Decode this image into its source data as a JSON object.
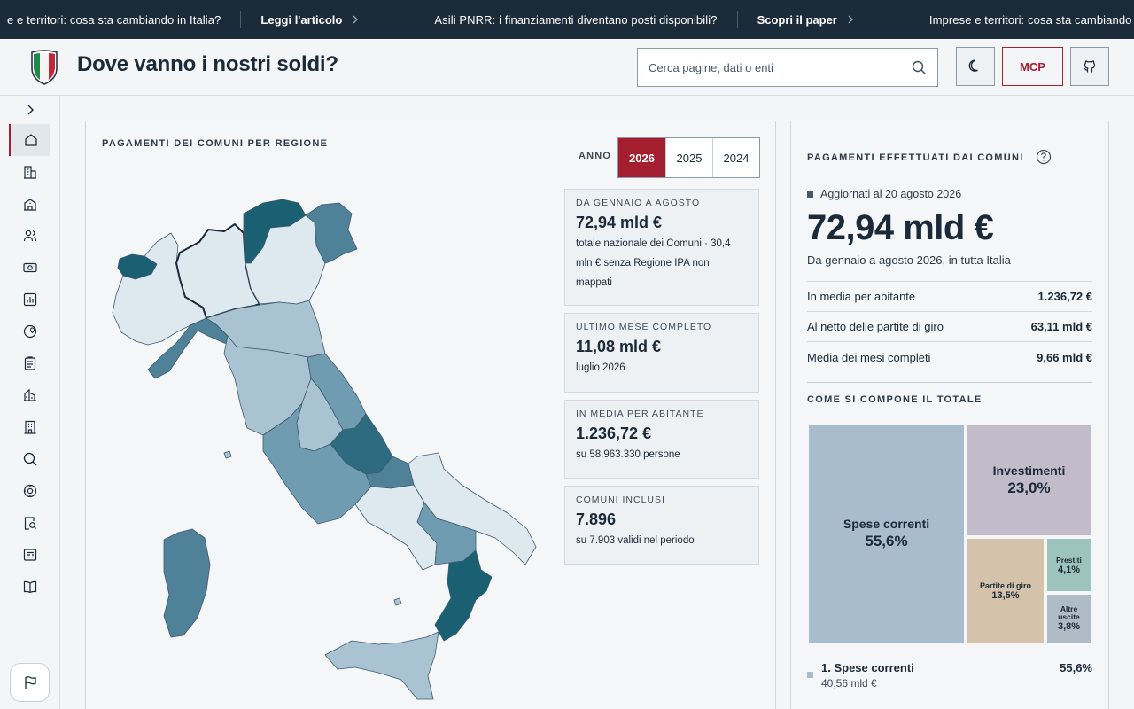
{
  "ticker": {
    "item1": "e e territori: cosa sta cambiando in Italia?",
    "cta1": "Leggi l'articolo",
    "item2": "Asili PNRR: i finanziamenti diventano posti disponibili?",
    "cta2": "Scopri il paper",
    "item3": "Imprese e territori: cosa sta cambiando in Italia?"
  },
  "header": {
    "title": "Dove vanno i nostri soldi?",
    "search_placeholder": "Cerca pagine, dati o enti",
    "mcp_label": "MCP"
  },
  "sidebar": {
    "items": [
      "expand-icon",
      "home-icon",
      "building-icon",
      "school-icon",
      "users-icon",
      "money-icon",
      "chart-icon",
      "map-pin-icon",
      "clipboard-icon",
      "library-icon",
      "office-icon",
      "search-icon",
      "settings-icon",
      "document-search-icon",
      "news-icon",
      "book-icon",
      "flag-icon"
    ]
  },
  "map_panel": {
    "title": "PAGAMENTI DEI COMUNI PER REGIONE",
    "year_label": "ANNO",
    "years": [
      "2026",
      "2025",
      "2024"
    ],
    "active_year": "2026",
    "cards": [
      {
        "key": "DA GENNAIO A AGOSTO",
        "value": "72,94 mld €",
        "desc": "totale nazionale dei Comuni · 30,4 mln € senza Regione IPA non mappati"
      },
      {
        "key": "ULTIMO MESE COMPLETO",
        "value": "11,08 mld €",
        "desc": "luglio 2026"
      },
      {
        "key": "IN MEDIA PER ABITANTE",
        "value": "1.236,72 €",
        "desc": "su 58.963.330 persone"
      },
      {
        "key": "COMUNI INCLUSI",
        "value": "7.896",
        "desc": "su 7.903 validi nel periodo"
      }
    ]
  },
  "side_panel": {
    "title": "PAGAMENTI EFFETTUATI DAI COMUNI",
    "updated": "Aggiornati al 20 agosto 2026",
    "total": "72,94 mld €",
    "total_sub": "Da gennaio a agosto 2026, in tutta Italia",
    "metrics": [
      {
        "label": "In media per abitante",
        "value": "1.236,72 €"
      },
      {
        "label": "Al netto delle partite di giro",
        "value": "63,11 mld €"
      },
      {
        "label": "Media dei mesi completi",
        "value": "9,66 mld €"
      }
    ],
    "composition_title": "COME SI COMPONE IL TOTALE",
    "treemap": [
      {
        "name": "Spese correnti",
        "pct": "55,6%",
        "color": "#a9bccd"
      },
      {
        "name": "Investimenti",
        "pct": "23,0%",
        "color": "#c2bbc9"
      },
      {
        "name": "Partite di giro",
        "pct": "13,5%",
        "color": "#d4c2aa"
      },
      {
        "name": "Prestiti",
        "pct": "4,1%",
        "color": "#9dc3bd"
      },
      {
        "name": "Altre uscite",
        "pct": "3,8%",
        "color": "#afbcc6"
      }
    ],
    "legend": {
      "name": "1. Spese correnti",
      "amount": "40,56 mld €",
      "pct": "55,6%"
    }
  },
  "colors": {
    "accent": "#a31f2f",
    "navy": "#1c2b3a",
    "map_dark": "#1b6072",
    "map_mid": "#4f8198",
    "map_light": "#a9c3d2",
    "map_pale": "#dde8ef"
  }
}
